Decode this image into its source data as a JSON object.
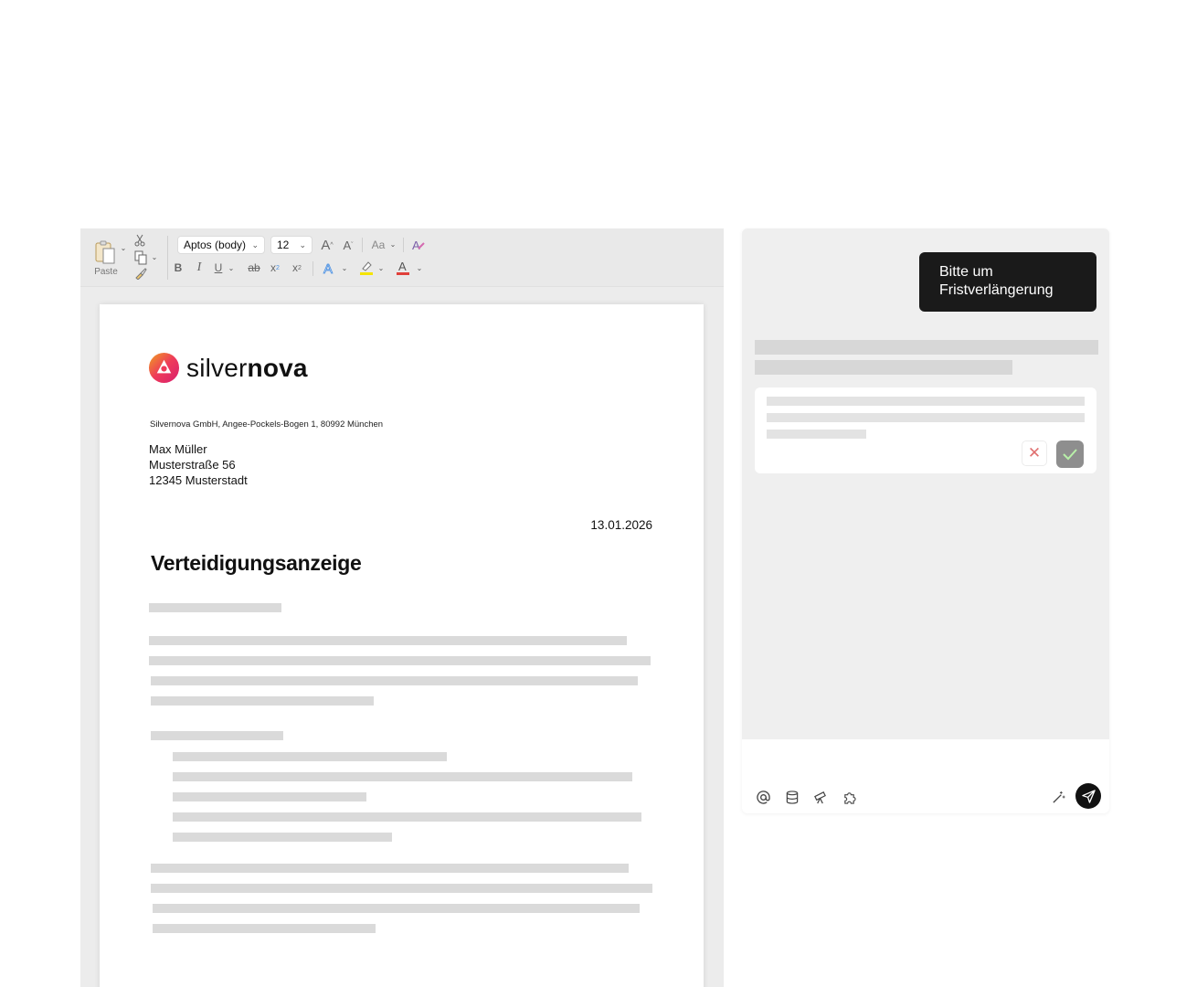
{
  "ribbon": {
    "paste_label": "Paste",
    "font_name": "Aptos (body)",
    "font_size": "12",
    "grow_font": "A",
    "shrink_font": "A",
    "change_case": "Aa",
    "bold": "B",
    "italic": "I",
    "underline": "U",
    "strikethrough": "ab",
    "subscript": "x",
    "superscript": "x",
    "highlight_color": "#f5e400",
    "font_color": "#e0403a"
  },
  "document": {
    "brand_light": "silver",
    "brand_bold": "nova",
    "sender_line": "Silvernova GmbH, Angee-Pockels-Bogen 1, 80992 München",
    "recipient": [
      "Max Müller",
      "Musterstraße 56",
      "12345 Musterstadt"
    ],
    "date": "13.01.2026",
    "title": "Verteidigungsanzeige"
  },
  "chat": {
    "user_message": "Bitte um Fristverlängerung",
    "reject_symbol": "✕"
  }
}
